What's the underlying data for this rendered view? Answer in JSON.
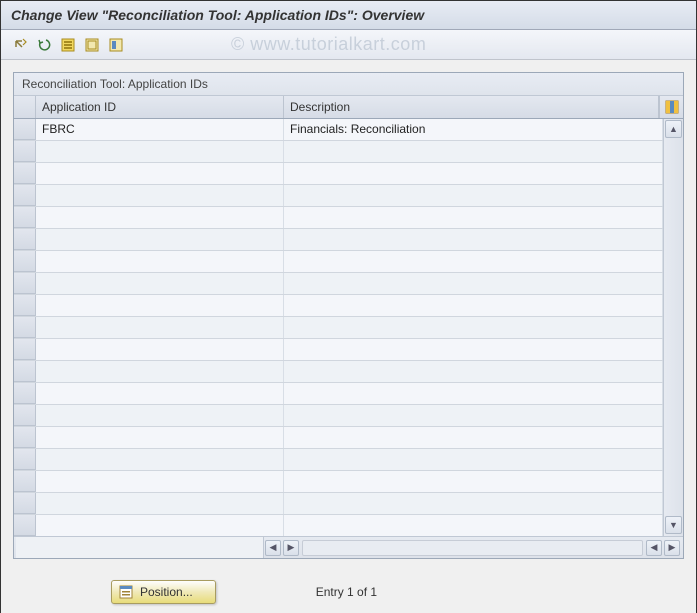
{
  "title": "Change View \"Reconciliation Tool: Application IDs\": Overview",
  "watermark": "© www.tutorialkart.com",
  "toolbar": {
    "icons": [
      "toggle-icon",
      "undo-icon",
      "select-all-icon",
      "deselect-all-icon",
      "select-block-icon"
    ]
  },
  "panel": {
    "title": "Reconciliation Tool: Application IDs",
    "columns": {
      "col1": "Application ID",
      "col2": "Description"
    },
    "rows": [
      {
        "app_id": "FBRC",
        "description": "Financials: Reconciliation"
      },
      {
        "app_id": "",
        "description": ""
      },
      {
        "app_id": "",
        "description": ""
      },
      {
        "app_id": "",
        "description": ""
      },
      {
        "app_id": "",
        "description": ""
      },
      {
        "app_id": "",
        "description": ""
      },
      {
        "app_id": "",
        "description": ""
      },
      {
        "app_id": "",
        "description": ""
      },
      {
        "app_id": "",
        "description": ""
      },
      {
        "app_id": "",
        "description": ""
      },
      {
        "app_id": "",
        "description": ""
      },
      {
        "app_id": "",
        "description": ""
      },
      {
        "app_id": "",
        "description": ""
      },
      {
        "app_id": "",
        "description": ""
      },
      {
        "app_id": "",
        "description": ""
      },
      {
        "app_id": "",
        "description": ""
      },
      {
        "app_id": "",
        "description": ""
      },
      {
        "app_id": "",
        "description": ""
      },
      {
        "app_id": "",
        "description": ""
      }
    ]
  },
  "footer": {
    "position_label": "Position...",
    "entry_text": "Entry 1 of 1"
  }
}
